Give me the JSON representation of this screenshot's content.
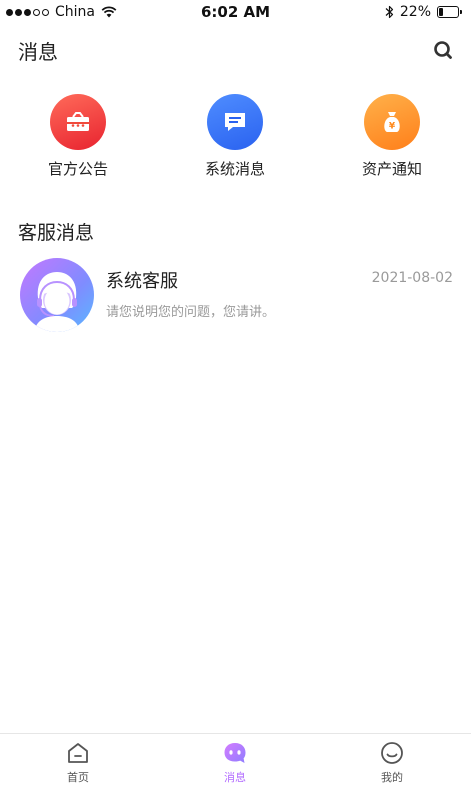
{
  "status_bar": {
    "carrier": "China",
    "time": "6:02 AM",
    "battery": "22%",
    "battery_level": 0.22
  },
  "header": {
    "title": "消息",
    "search_icon": "search-icon"
  },
  "categories": [
    {
      "label": "官方公告",
      "icon": "announcement-icon",
      "color": "#e8232f"
    },
    {
      "label": "系统消息",
      "icon": "message-icon",
      "color": "#2a62f0"
    },
    {
      "label": "资产通知",
      "icon": "money-bag-icon",
      "color": "#ff7f1a"
    }
  ],
  "section": {
    "title": "客服消息"
  },
  "service_item": {
    "name": "系统客服",
    "date": "2021-08-02",
    "preview": "请您说明您的问题，您请讲。",
    "avatar_icon": "customer-service-avatar"
  },
  "tab_bar": {
    "tabs": [
      {
        "label": "首页",
        "icon": "home-icon",
        "active": false
      },
      {
        "label": "消息",
        "icon": "chat-icon",
        "active": true
      },
      {
        "label": "我的",
        "icon": "profile-icon",
        "active": false
      }
    ],
    "active_color": "#b26bff"
  }
}
